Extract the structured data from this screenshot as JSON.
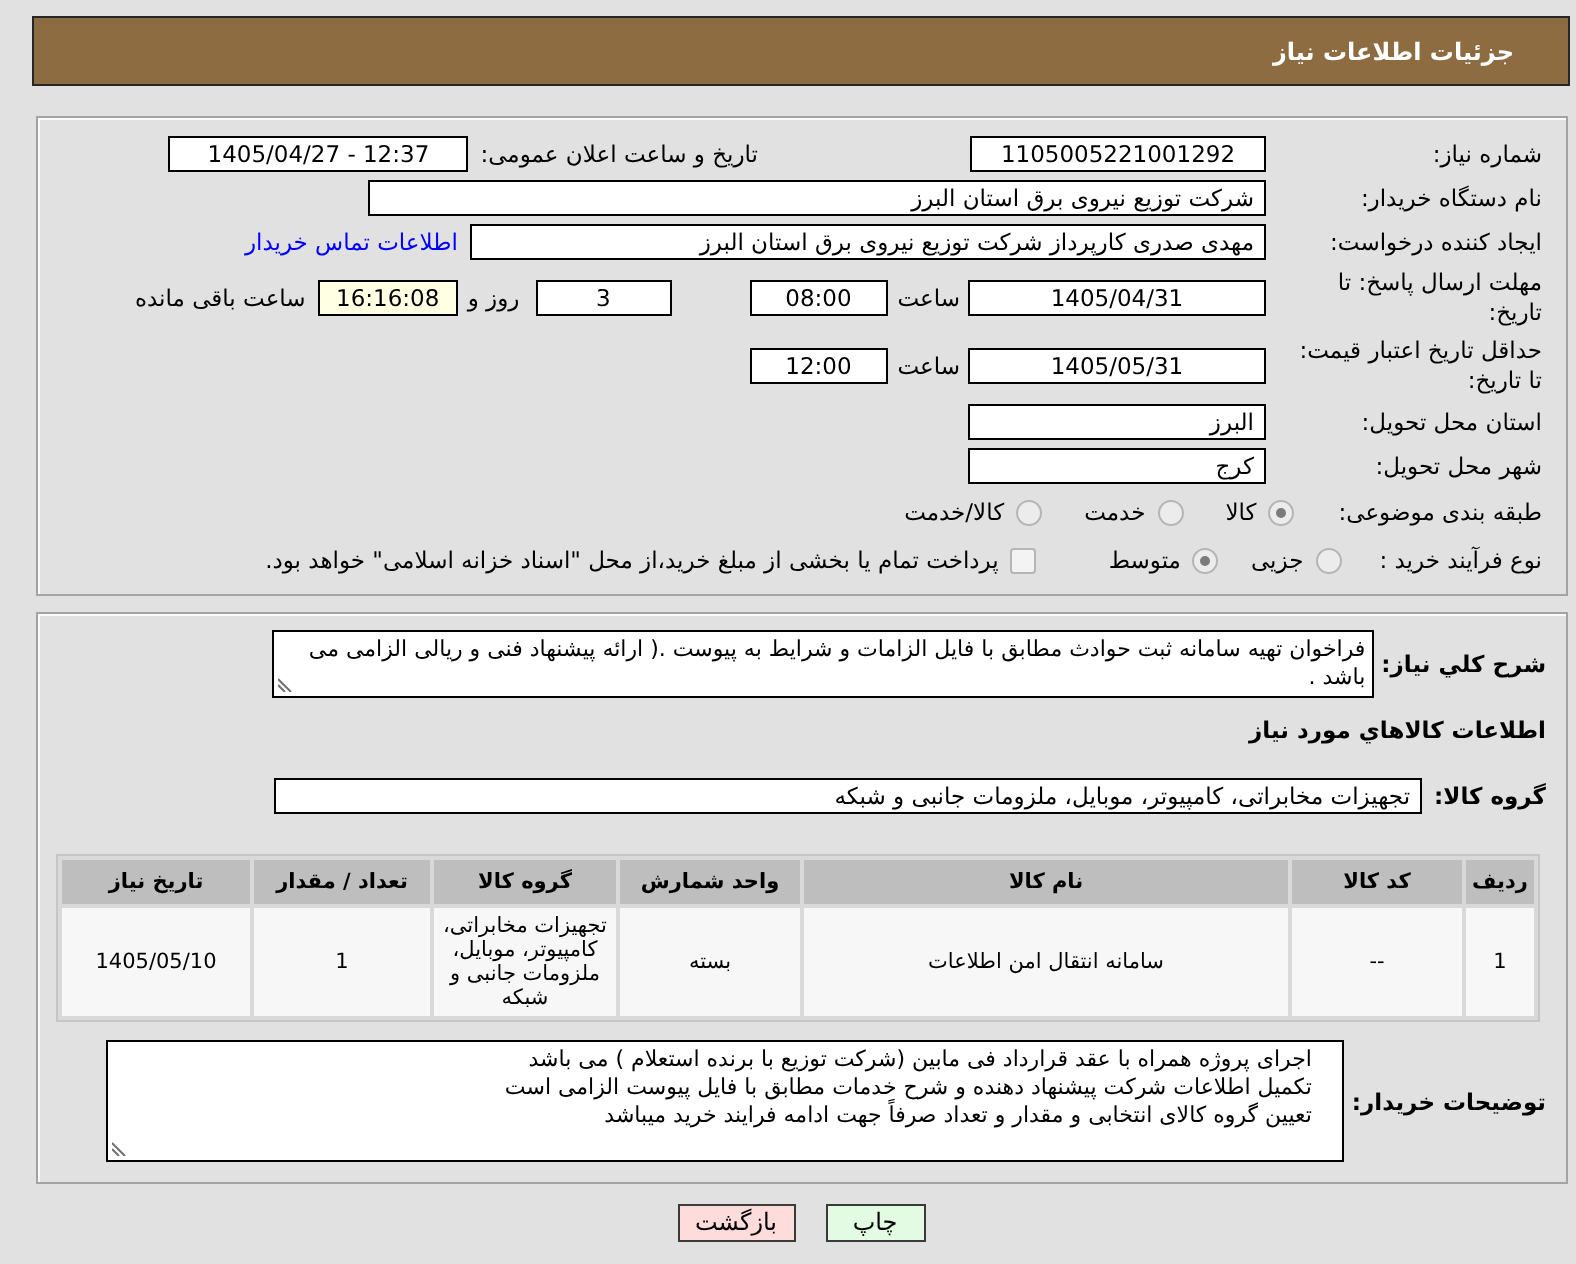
{
  "header": {
    "title": "جزئیات اطلاعات نیاز"
  },
  "details": {
    "need_number": {
      "label": "شماره نیاز:",
      "value": "1105005221001292"
    },
    "announced": {
      "label": "تاریخ و ساعت اعلان عمومی:",
      "value": "1405/04/27 - 12:37"
    },
    "buyer_organization": {
      "label": "نام دستگاه خریدار:",
      "value": "شرکت توزیع نیروی برق استان البرز"
    },
    "requester": {
      "label": "ایجاد کننده درخواست:",
      "value": "مهدی صدری کارپرداز شرکت توزیع نیروی برق استان البرز",
      "contact_link": "اطلاعات تماس خریدار"
    },
    "reply_deadline": {
      "label": "مهلت ارسال پاسخ: تا تاریخ:",
      "date": "1405/04/31",
      "time_label": "ساعت",
      "time": "08:00",
      "days": "3",
      "days_label": "روز و",
      "remaining_time": "16:16:08",
      "remaining_label": "ساعت باقی مانده"
    },
    "price_validity": {
      "label": "حداقل تاریخ اعتبار قیمت: تا تاریخ:",
      "date": "1405/05/31",
      "time_label": "ساعت",
      "time": "12:00"
    },
    "delivery_province": {
      "label": "استان محل تحویل:",
      "value": "البرز"
    },
    "delivery_city": {
      "label": "شهر محل تحویل:",
      "value": "کرج"
    },
    "subject_category": {
      "label": "طبقه بندی موضوعی:",
      "options": [
        {
          "label": "کالا",
          "selected": true
        },
        {
          "label": "خدمت",
          "selected": false
        },
        {
          "label": "کالا/خدمت",
          "selected": false
        }
      ]
    },
    "purchase_type": {
      "label": "نوع فرآیند خرید :",
      "options": [
        {
          "label": "جزیی",
          "selected": false
        },
        {
          "label": "متوسط",
          "selected": true
        }
      ],
      "treasury_payment": {
        "label": "پرداخت تمام یا بخشی از مبلغ خرید،از محل \"اسناد خزانه اسلامی\" خواهد بود.",
        "checked": false
      }
    }
  },
  "need_description": {
    "label": "شرح کلي نیاز:",
    "text": "فراخوان تهیه سامانه ثبت حوادث مطابق با فایل الزامات و شرایط به پیوست .( ارائه پیشنهاد فنی و ریالی الزامی می باشد ."
  },
  "goods": {
    "title": "اطلاعات کالاهاي مورد نیاز",
    "group_label": "گروه کالا:",
    "group_value": "تجهیزات مخابراتی، کامپیوتر، موبایل، ملزومات جانبی و شبکه",
    "table": {
      "columns": [
        "ردیف",
        "کد کالا",
        "نام کالا",
        "واحد شمارش",
        "گروه کالا",
        "تعداد / مقدار",
        "تاریخ نیاز"
      ],
      "rows": [
        [
          "1",
          "--",
          "سامانه انتقال امن اطلاعات",
          "بسته",
          "تجهیزات مخابراتی، کامپیوتر، موبایل، ملزومات جانبی و شبکه",
          "1",
          "1405/05/10"
        ]
      ]
    }
  },
  "buyer_notes": {
    "label": "توضیحات خریدار:",
    "lines": [
      "اجرای پروژه همراه با عقد قرارداد فی مابین (شرکت توزیع با برنده استعلام ) می باشد",
      "تکمیل اطلاعات شرکت پیشنهاد دهنده و شرح خدمات مطابق با فایل پیوست الزامی است",
      "تعیین گروه کالای انتخابی و مقدار و تعداد صرفاً جهت ادامه فرایند خرید میباشد"
    ]
  },
  "buttons": [
    {
      "kind": "print",
      "label": "چاپ"
    },
    {
      "kind": "back",
      "label": "بازگشت"
    }
  ]
}
